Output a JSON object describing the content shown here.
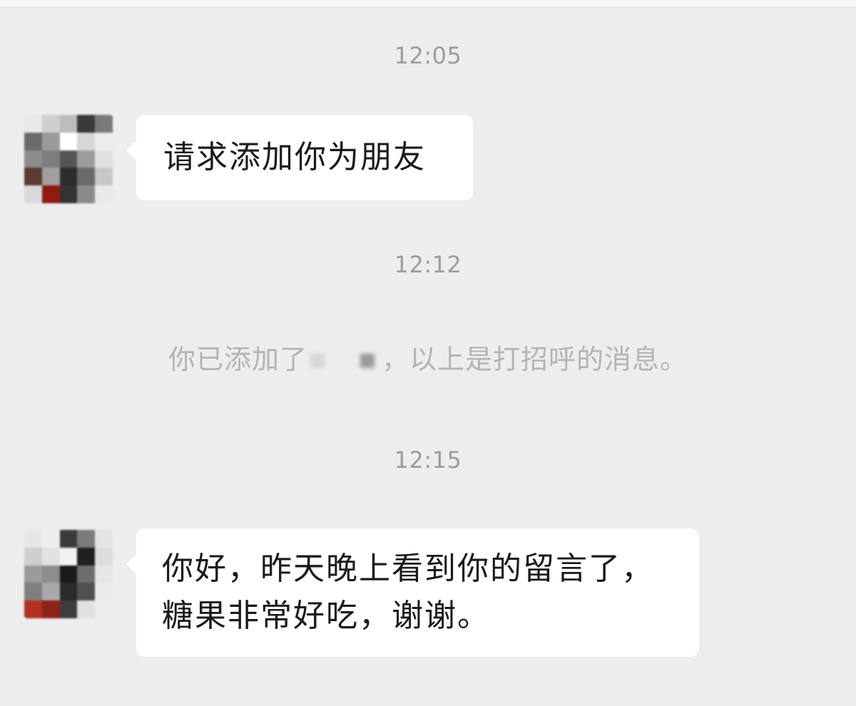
{
  "conversation": {
    "timestamps": [
      "12:05",
      "12:12",
      "12:15"
    ],
    "messages": [
      {
        "sender": "contact",
        "text": "请求添加你为朋友"
      },
      {
        "sender": "contact",
        "lines": [
          "你好，昨天晚上看到你的留言了，",
          "糖果非常好吃，谢谢。"
        ]
      }
    ],
    "system_message": {
      "prefix": "你已添加了",
      "suffix": "，以上是打招呼的消息。"
    }
  },
  "colors": {
    "background": "#ededed",
    "bubble": "#ffffff",
    "timestamp_text": "#9c9c9c",
    "system_text": "#b4b4b4"
  }
}
